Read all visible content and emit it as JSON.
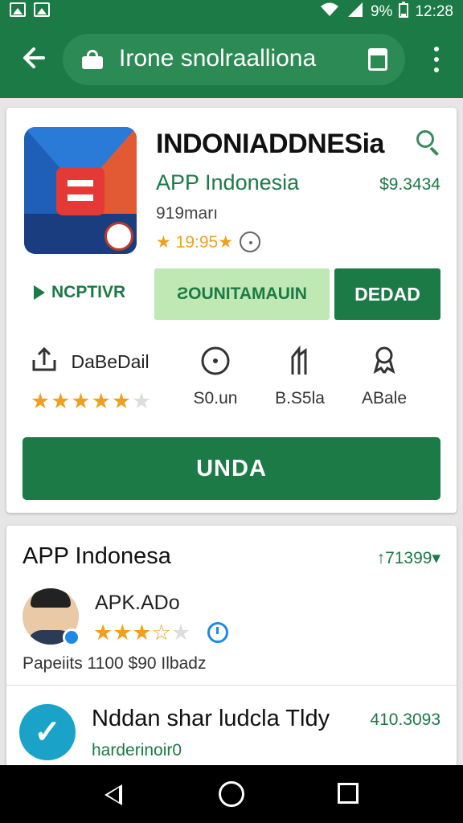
{
  "status_bar": {
    "battery": "9%",
    "time": "12:28"
  },
  "header": {
    "url": "Irone snolraalliona"
  },
  "app": {
    "title": "INDONIADDNESia",
    "developer": "APP Indonesia",
    "price": "$9.3434",
    "size": "919marı",
    "rating_text": "★ 19:95★",
    "publisher_label": "NCPTIVR",
    "secondary_button": "ƧOUNITAMAUIN",
    "primary_button": "DEDAD",
    "install_button": "UNDA"
  },
  "stats": [
    {
      "icon": "share-icon",
      "label": "DaBeDail",
      "rating": 4.5
    },
    {
      "icon": "target-icon",
      "label": "S0.un"
    },
    {
      "icon": "trend-icon",
      "label": "B.S5la"
    },
    {
      "icon": "award-icon",
      "label": "ABale"
    }
  ],
  "reviews_section": {
    "title": "APP Indonesa",
    "count": "↑71399▾",
    "review": {
      "name": "APK.ADo",
      "rating": 3.5,
      "meta": "Papeiits 1100 $90 Ilbadz"
    },
    "item2": {
      "title": "Nddan shar ludcla Tldy",
      "price": "410.3093",
      "sub": "harderinoir0"
    }
  },
  "colors": {
    "primary": "#1b7a45",
    "accent_light": "#bfe8b4",
    "star": "#f0a020",
    "info_blue": "#1e88e5"
  }
}
